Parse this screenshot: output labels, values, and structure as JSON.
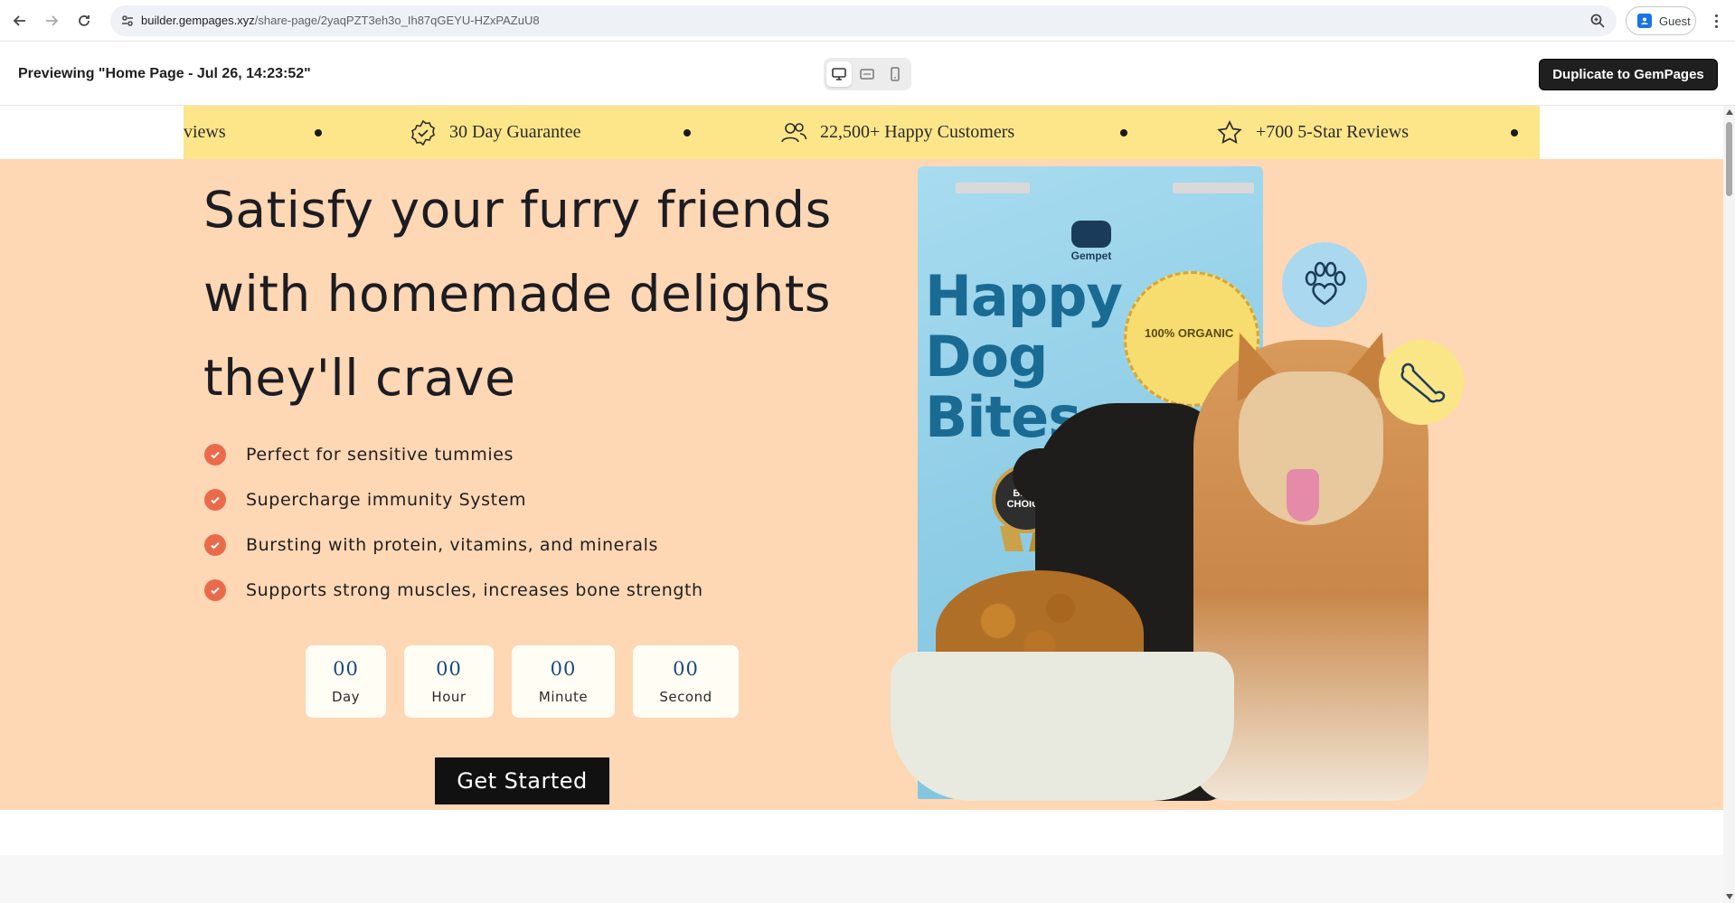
{
  "browser": {
    "url_host": "builder.gempages.xyz",
    "url_path": "/share-page/2yaqPZT3eh3o_Ih87qGEYU-HZxPAZuU8",
    "profile_label": "Guest"
  },
  "preview": {
    "title": "Previewing \"Home Page - Jul 26, 14:23:52\"",
    "duplicate_label": "Duplicate to GemPages"
  },
  "marquee": {
    "items": [
      {
        "label": "views",
        "icon": "none"
      },
      {
        "label": "30 Day Guarantee",
        "icon": "badge-check-icon"
      },
      {
        "label": "22,500+ Happy Customers",
        "icon": "users-icon"
      },
      {
        "label": "+700 5-Star Reviews",
        "icon": "star-icon"
      }
    ]
  },
  "hero": {
    "title": "Satisfy your furry friends with homemade delights they'll crave",
    "benefits": [
      "Perfect for sensitive tummies",
      "Supercharge immunity System",
      "Bursting with protein, vitamins, and minerals",
      "Supports strong muscles, increases bone strength"
    ],
    "countdown": [
      {
        "value": "00",
        "label": "Day"
      },
      {
        "value": "00",
        "label": "Hour"
      },
      {
        "value": "00",
        "label": "Minute"
      },
      {
        "value": "00",
        "label": "Second"
      }
    ],
    "cta_label": "Get Started"
  },
  "product": {
    "brand": "Gempet",
    "name": "Happy Dog Bites",
    "organic_label": "100% ORGANIC",
    "badge_label": "BEST CHOICE"
  },
  "colors": {
    "marquee_bg": "#fde68a",
    "hero_bg": "#fed7b5",
    "check_color": "#ea6b4c",
    "cta_bg": "#111111",
    "countdown_num": "#1b4a7a"
  }
}
